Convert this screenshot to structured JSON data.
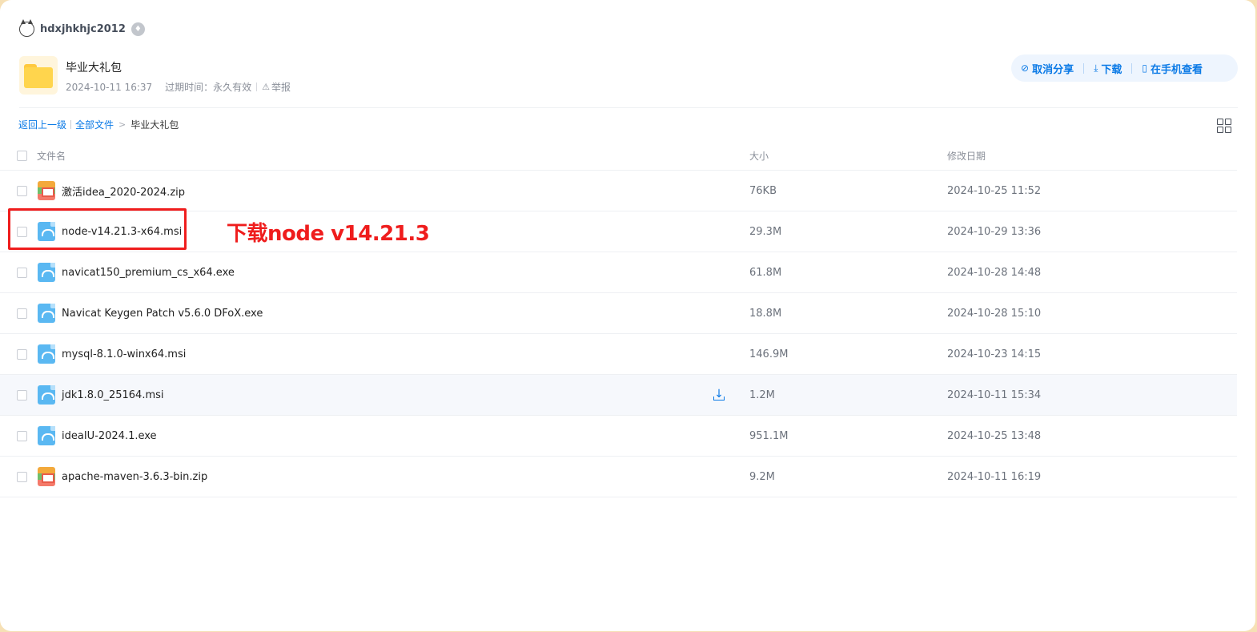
{
  "user": {
    "name": "hdxjhkhjc2012",
    "vip_icon": "vip-diamond-icon"
  },
  "share": {
    "title": "毕业大礼包",
    "date": "2024-10-11 16:37",
    "expire_label": "过期时间：",
    "expire_value": "永久有效",
    "report_label": "举报"
  },
  "actions": {
    "cancel_share": "取消分享",
    "download": "下载",
    "view_on_phone": "在手机查看"
  },
  "breadcrumb": {
    "back": "返回上一级",
    "all_files": "全部文件",
    "current": "毕业大礼包",
    "separator": ">"
  },
  "table": {
    "headers": {
      "name": "文件名",
      "size": "大小",
      "date": "修改日期"
    },
    "rows": [
      {
        "name": "激活idea_2020-2024.zip",
        "size": "76KB",
        "date": "2024-10-25 11:52",
        "type": "zip"
      },
      {
        "name": "node-v14.21.3-x64.msi",
        "size": "29.3M",
        "date": "2024-10-29 13:36",
        "type": "msi"
      },
      {
        "name": "navicat150_premium_cs_x64.exe",
        "size": "61.8M",
        "date": "2024-10-28 14:48",
        "type": "msi"
      },
      {
        "name": "Navicat Keygen Patch v5.6.0 DFoX.exe",
        "size": "18.8M",
        "date": "2024-10-28 15:10",
        "type": "msi"
      },
      {
        "name": "mysql-8.1.0-winx64.msi",
        "size": "146.9M",
        "date": "2024-10-23 14:15",
        "type": "msi"
      },
      {
        "name": "jdk1.8.0_25164.msi",
        "size": "1.2M",
        "date": "2024-10-11 15:34",
        "type": "msi",
        "hover": true
      },
      {
        "name": "ideaIU-2024.1.exe",
        "size": "951.1M",
        "date": "2024-10-25 13:48",
        "type": "msi"
      },
      {
        "name": "apache-maven-3.6.3-bin.zip",
        "size": "9.2M",
        "date": "2024-10-11 16:19",
        "type": "zip"
      }
    ]
  },
  "annotation": {
    "text": "下载node v14.21.3",
    "color": "#ef1d1d"
  },
  "colors": {
    "accent": "#0b7ae6",
    "frame_bg": "#f6e0b5"
  }
}
